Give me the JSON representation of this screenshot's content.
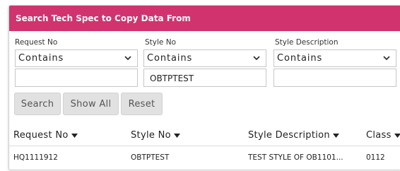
{
  "dialog": {
    "title": "Search Tech Spec to Copy Data From",
    "header_color": "#d1336e"
  },
  "filters": {
    "request_no": {
      "label": "Request No",
      "operator": "Contains",
      "value": ""
    },
    "style_no": {
      "label": "Style No",
      "operator": "Contains",
      "value": "OBTPTEST"
    },
    "style_description": {
      "label": "Style Description",
      "operator": "Contains",
      "value": ""
    }
  },
  "buttons": {
    "search": "Search",
    "show_all": "Show All",
    "reset": "Reset"
  },
  "table": {
    "headers": {
      "request_no": "Request No",
      "style_no": "Style No",
      "style_description": "Style Description",
      "class": "Class"
    },
    "rows": [
      {
        "request_no": "HQ1111912",
        "style_no": "OBTPTEST",
        "style_description": "TEST STYLE OF OB1101...",
        "class": "0112"
      }
    ]
  }
}
